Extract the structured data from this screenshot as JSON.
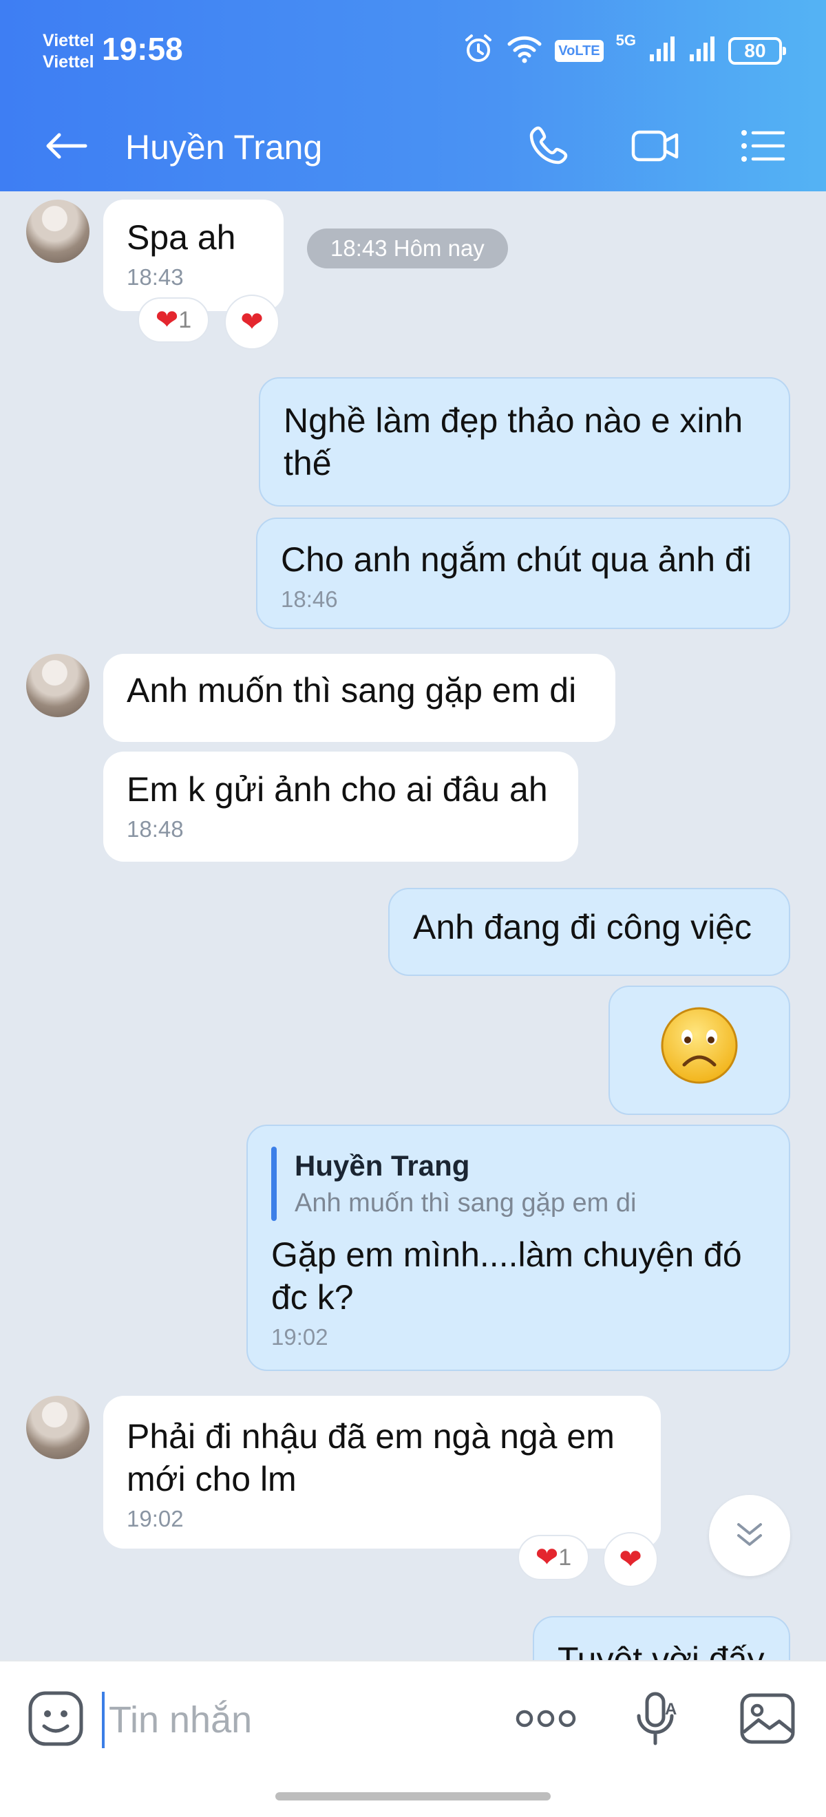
{
  "status_bar": {
    "carrier_top": "Viettel",
    "carrier_bottom": "Viettel",
    "time": "19:58",
    "volte_label": "VoLTE",
    "network_label": "5G",
    "battery": "80"
  },
  "header": {
    "contact_name": "Huyền Trang",
    "icons": [
      "back-arrow-icon",
      "phone-icon",
      "video-camera-icon",
      "menu-list-icon"
    ]
  },
  "messages": {
    "m1": {
      "text": "Spa ah",
      "time": "18:43"
    },
    "date_pill": "18:43 Hôm nay",
    "m1_reaction_count": "1",
    "m2": {
      "text": "Nghề làm đẹp thảo nào e xinh thế"
    },
    "m3": {
      "text": "Cho anh ngắm chút qua ảnh đi",
      "time": "18:46"
    },
    "m4": {
      "text": "Anh muốn thì sang gặp em di"
    },
    "m5": {
      "text": "Em k gửi ảnh cho ai đâu ah",
      "time": "18:48"
    },
    "m6": {
      "text": "Anh đang đi công việc"
    },
    "m7": {
      "sticker": "sad-face-emoji"
    },
    "m8": {
      "quote_name": "Huyền Trang",
      "quote_text": "Anh muốn thì sang gặp em di",
      "text": "Gặp em mình....làm chuyện đó đc k?",
      "time": "19:02"
    },
    "m9": {
      "text": "Phải đi nhậu đã em ngà ngà em mới cho lm",
      "time": "19:02"
    },
    "m9_reaction_count": "1",
    "m10": {
      "text": "Tuyệt vời đấy"
    }
  },
  "composer": {
    "placeholder": "Tin nhắn",
    "icons": [
      "sticker-icon",
      "more-icon",
      "voice-icon",
      "image-icon"
    ]
  },
  "colors": {
    "header_start": "#3e7ef3",
    "header_end": "#54b3f4",
    "chat_background": "#e2e8f0",
    "incoming_bubble": "#ffffff",
    "outgoing_bubble": "#d5ebfd",
    "heart": "#e4262e"
  }
}
